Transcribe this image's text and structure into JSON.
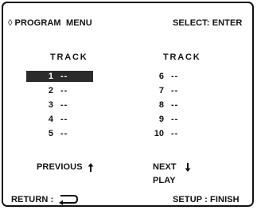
{
  "header": {
    "diamond": "◊",
    "title": "PROGRAM  MENU",
    "select_hint": "SELECT: ENTER"
  },
  "left": {
    "heading": "TRACK",
    "tracks": [
      {
        "num": "1",
        "value": "--"
      },
      {
        "num": "2",
        "value": "--"
      },
      {
        "num": "3",
        "value": "--"
      },
      {
        "num": "4",
        "value": "--"
      },
      {
        "num": "5",
        "value": "--"
      }
    ],
    "selected_index": 0
  },
  "right": {
    "heading": "TRACK",
    "tracks": [
      {
        "num": "6",
        "value": "--"
      },
      {
        "num": "7",
        "value": "--"
      },
      {
        "num": "8",
        "value": "--"
      },
      {
        "num": "9",
        "value": "--"
      },
      {
        "num": "10",
        "value": "--"
      }
    ]
  },
  "nav": {
    "previous": "PREVIOUS",
    "next": "NEXT",
    "play": "PLAY"
  },
  "footer": {
    "return": "RETURN :",
    "setup": "SETUP : FINISH"
  },
  "icons": {
    "previous": "arrow-up-icon",
    "next": "arrow-down-icon",
    "return": "return-arrow-icon"
  }
}
